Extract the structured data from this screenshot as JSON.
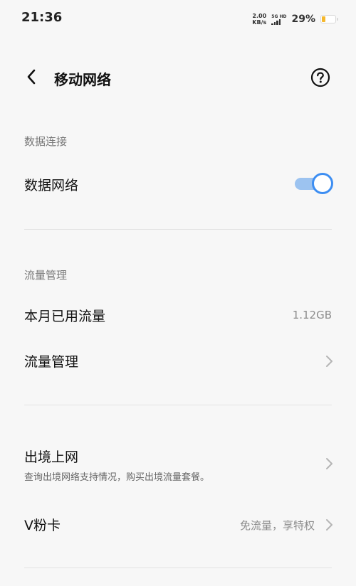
{
  "status_bar": {
    "time": "21:36",
    "net_speed_value": "2.00",
    "net_speed_unit": "KB/s",
    "network_type": "5G HD",
    "battery_percent": "29%",
    "battery_level": 0.29,
    "battery_color": "#f5b82e"
  },
  "header": {
    "title": "移动网络",
    "back_icon": "chevron-left-icon",
    "help_icon": "question-circle-icon"
  },
  "data_connection": {
    "section_label": "数据连接",
    "mobile_data_label": "数据网络",
    "mobile_data_enabled": true,
    "accent_color": "#3d8ef2"
  },
  "traffic": {
    "section_label": "流量管理",
    "used_label": "本月已用流量",
    "used_value": "1.12GB",
    "manage_label": "流量管理"
  },
  "roaming": {
    "label": "出境上网",
    "description": "查询出境网络支持情况，购买出境流量套餐。"
  },
  "vcard": {
    "label": "V粉卡",
    "value": "免流量，享特权"
  }
}
